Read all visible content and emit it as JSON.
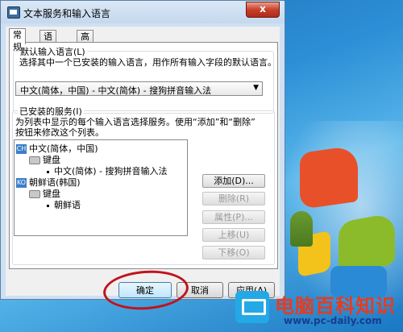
{
  "window": {
    "title": "文本服务和输入语言",
    "close_glyph": "x"
  },
  "tabs": [
    {
      "label": "常规",
      "active": true
    },
    {
      "label": "语言栏",
      "active": false
    },
    {
      "label": "高级键设置",
      "active": false
    }
  ],
  "default_group": {
    "title": "默认输入语言(L)",
    "description": "选择其中一个已安装的输入语言，用作所有输入字段的默认语言。",
    "selected": "中文(简体，中国) - 中文(简体) - 搜狗拼音输入法"
  },
  "installed_group": {
    "title": "已安装的服务(I)",
    "description_line1": "为列表中显示的每个输入语言选择服务。使用“添加”和“删除”",
    "description_line2": "按钮来修改这个列表。",
    "tree": [
      {
        "badge": "CH",
        "label": "中文(简体，中国)"
      },
      {
        "label": "键盘"
      },
      {
        "label": "中文(简体) - 搜狗拼音输入法"
      },
      {
        "badge": "KO",
        "label": "朝鲜语(韩国)"
      },
      {
        "label": "键盘"
      },
      {
        "label": "朝鲜语"
      }
    ],
    "buttons": {
      "add": "添加(D)...",
      "remove": "删除(R)",
      "properties": "属性(P)...",
      "move_up": "上移(U)",
      "move_down": "下移(O)"
    }
  },
  "footer": {
    "ok": "确定",
    "cancel": "取消",
    "apply": "应用(A)"
  },
  "watermark": {
    "title": "电脑百科知识",
    "url": "www.pc-daily.com"
  },
  "colors": {
    "annotation_circle": "#c0141c",
    "accent": "#3c7fc8"
  }
}
